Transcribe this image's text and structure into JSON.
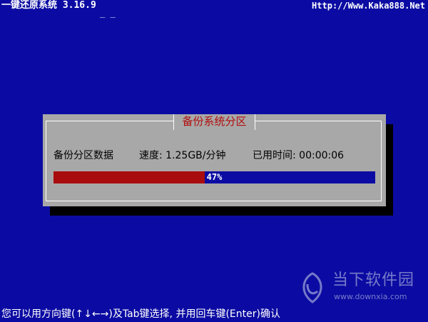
{
  "header": {
    "app_title": "一键还原系统 3.16.9",
    "cursor": "_ _",
    "site_url": "Http://Www.Kaka888.Net"
  },
  "dialog": {
    "title": "备份系统分区",
    "task_label": "备份分区数据",
    "speed": "速度: 1.25GB/分钟",
    "elapsed": "已用时间: 00:00:06",
    "progress_text": "47%",
    "progress_fraction": 0.47
  },
  "footer": {
    "hint": "您可以用方向键(↑↓←→)及Tab键选择, 并用回车键(Enter)确认"
  },
  "watermark": {
    "brand": "当下软件园",
    "url": "www.downxia.com",
    "icon": "downxia-logo-icon"
  },
  "colors": {
    "background": "#0b0ba3",
    "dialog": "#a8a8a8",
    "progress_fill": "#a80c0c",
    "title_text": "#b10d0d"
  }
}
